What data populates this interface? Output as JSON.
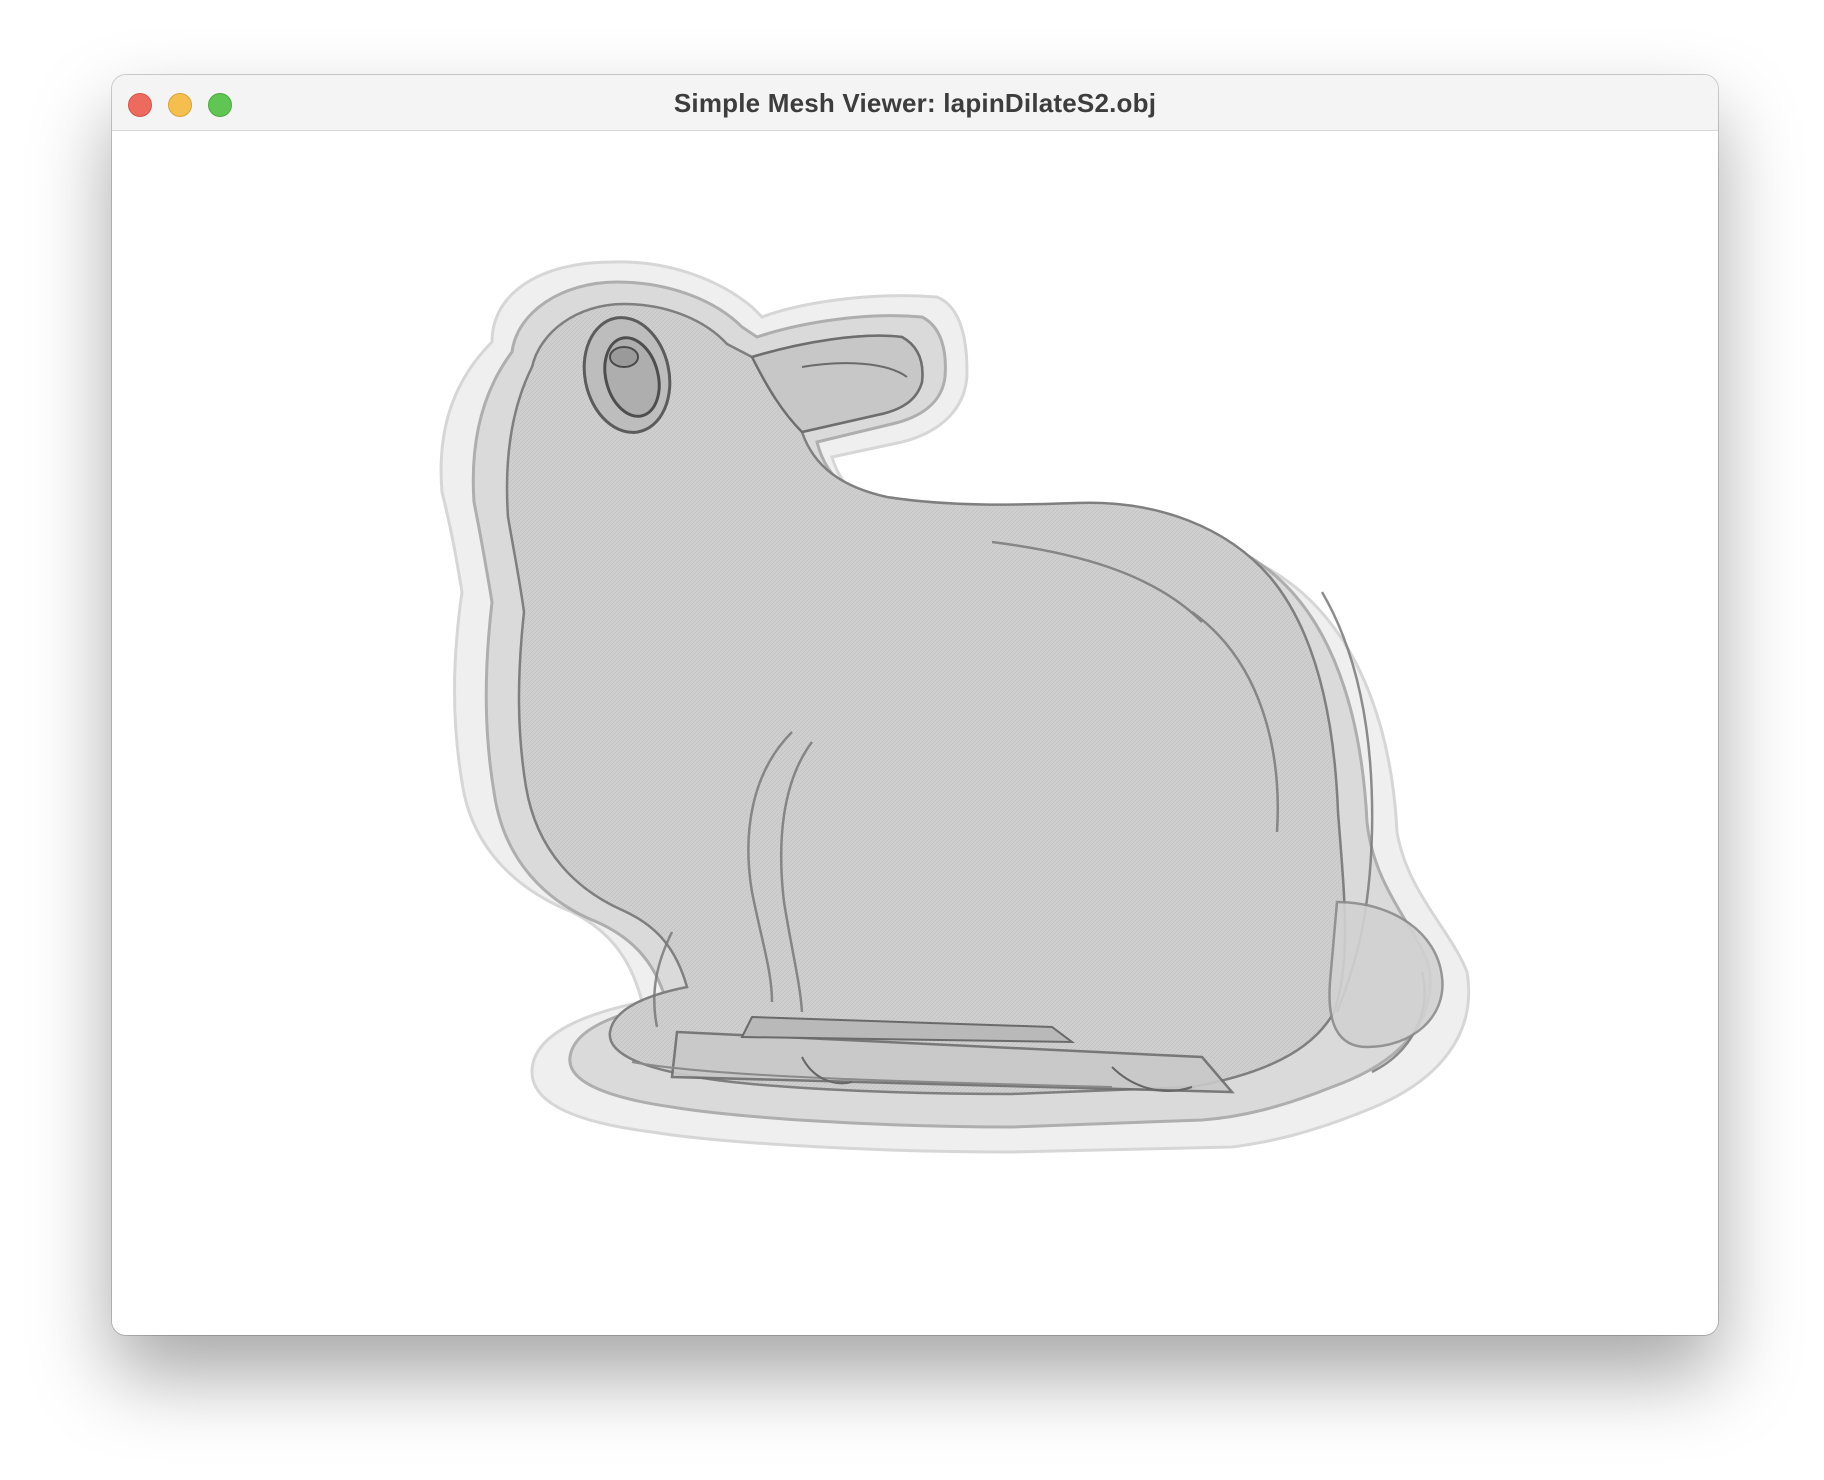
{
  "window": {
    "title": "Simple Mesh Viewer: lapinDilateS2.obj"
  },
  "traffic_lights": {
    "close_color": "#ed6a5e",
    "minimize_color": "#f5bf4f",
    "zoom_color": "#61c554"
  },
  "viewport": {
    "background": "#ffffff",
    "mesh_color": "#9a9a9a",
    "model_name": "lapinDilateS2.obj"
  }
}
